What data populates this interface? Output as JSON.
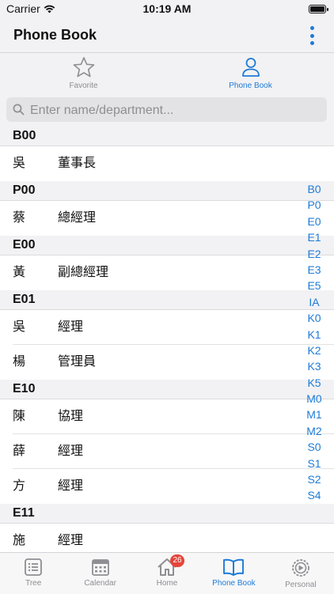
{
  "status": {
    "carrier": "Carrier",
    "time": "10:19 AM"
  },
  "header": {
    "title": "Phone Book"
  },
  "tabs": [
    {
      "label": "Favorite",
      "icon": "star-icon",
      "active": false
    },
    {
      "label": "Phone Book",
      "icon": "person-icon",
      "active": true
    }
  ],
  "search": {
    "placeholder": "Enter name/department...",
    "value": ""
  },
  "sections": [
    {
      "header": "B00",
      "rows": [
        {
          "name": "吳",
          "title": "董事長"
        }
      ]
    },
    {
      "header": "P00",
      "rows": [
        {
          "name": "蔡",
          "title": "總經理"
        }
      ]
    },
    {
      "header": "E00",
      "rows": [
        {
          "name": "黃",
          "title": "副總經理"
        }
      ]
    },
    {
      "header": "E01",
      "rows": [
        {
          "name": "吳",
          "title": "經理"
        },
        {
          "name": "楊",
          "title": "管理員"
        }
      ]
    },
    {
      "header": "E10",
      "rows": [
        {
          "name": "陳",
          "title": "協理"
        },
        {
          "name": "薛",
          "title": "經理"
        },
        {
          "name": "方",
          "title": "經理"
        }
      ]
    },
    {
      "header": "E11",
      "rows": [
        {
          "name": "施",
          "title": "經理"
        }
      ]
    }
  ],
  "index": [
    "B0",
    "P0",
    "E0",
    "E1",
    "E2",
    "E3",
    "E5",
    "IA",
    "K0",
    "K1",
    "K2",
    "K3",
    "K5",
    "M0",
    "M1",
    "M2",
    "S0",
    "S1",
    "S2",
    "S4"
  ],
  "tabbar": [
    {
      "label": "Tree",
      "icon": "list-icon",
      "active": false
    },
    {
      "label": "Calendar",
      "icon": "calendar-icon",
      "active": false
    },
    {
      "label": "Home",
      "icon": "home-icon",
      "active": false,
      "badge": "26"
    },
    {
      "label": "Phone Book",
      "icon": "book-icon",
      "active": true
    },
    {
      "label": "Personal",
      "icon": "settings-icon",
      "active": false
    }
  ],
  "colors": {
    "accent": "#1e7bd6",
    "badge": "#e5453a",
    "inactive": "#8e8e93"
  }
}
